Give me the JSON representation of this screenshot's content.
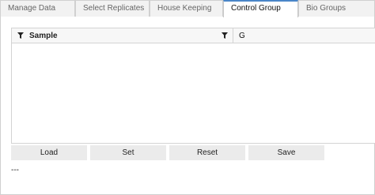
{
  "tabs": [
    {
      "label": "Manage Data",
      "active": false
    },
    {
      "label": "Select Replicates",
      "active": false
    },
    {
      "label": "House Keeping",
      "active": false
    },
    {
      "label": "Control Group",
      "active": true
    },
    {
      "label": "Bio Groups",
      "active": false
    }
  ],
  "grid": {
    "columns": [
      {
        "label": "Sample",
        "icon": "filter-icon"
      },
      {
        "label": "G"
      }
    ],
    "rows": []
  },
  "buttons": {
    "load": "Load",
    "set": "Set",
    "reset": "Reset",
    "save": "Save"
  },
  "status": "---",
  "colors": {
    "active_tab_accent": "#4a86c8",
    "button_bg": "#ebebeb"
  }
}
